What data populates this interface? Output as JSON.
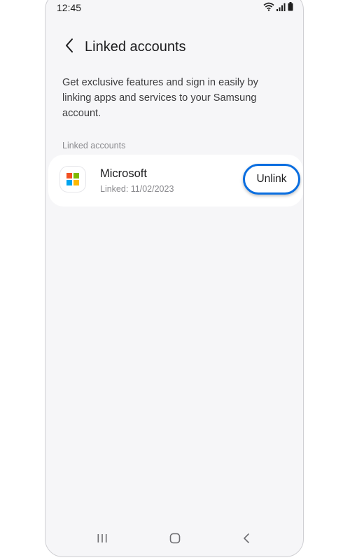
{
  "status_bar": {
    "time": "12:45",
    "icons": [
      "wifi-icon",
      "signal-icon",
      "battery-icon"
    ]
  },
  "header": {
    "title": "Linked accounts",
    "back_icon": "chevron-left-icon"
  },
  "description": "Get exclusive features and sign in easily by linking apps and services to your Samsung account.",
  "section_label": "Linked accounts",
  "accounts": [
    {
      "name": "Microsoft",
      "linked": "Linked: 11/02/2023",
      "action_label": "Unlink",
      "icon": "microsoft-logo-icon"
    }
  ],
  "nav_bar": {
    "items": [
      "recent-apps-icon",
      "home-icon",
      "back-icon"
    ]
  },
  "colors": {
    "highlight": "#0a6ee0",
    "background": "#f6f6f8",
    "ms_red": "#f25022",
    "ms_green": "#7fba00",
    "ms_blue": "#00a4ef",
    "ms_yellow": "#ffb900"
  }
}
